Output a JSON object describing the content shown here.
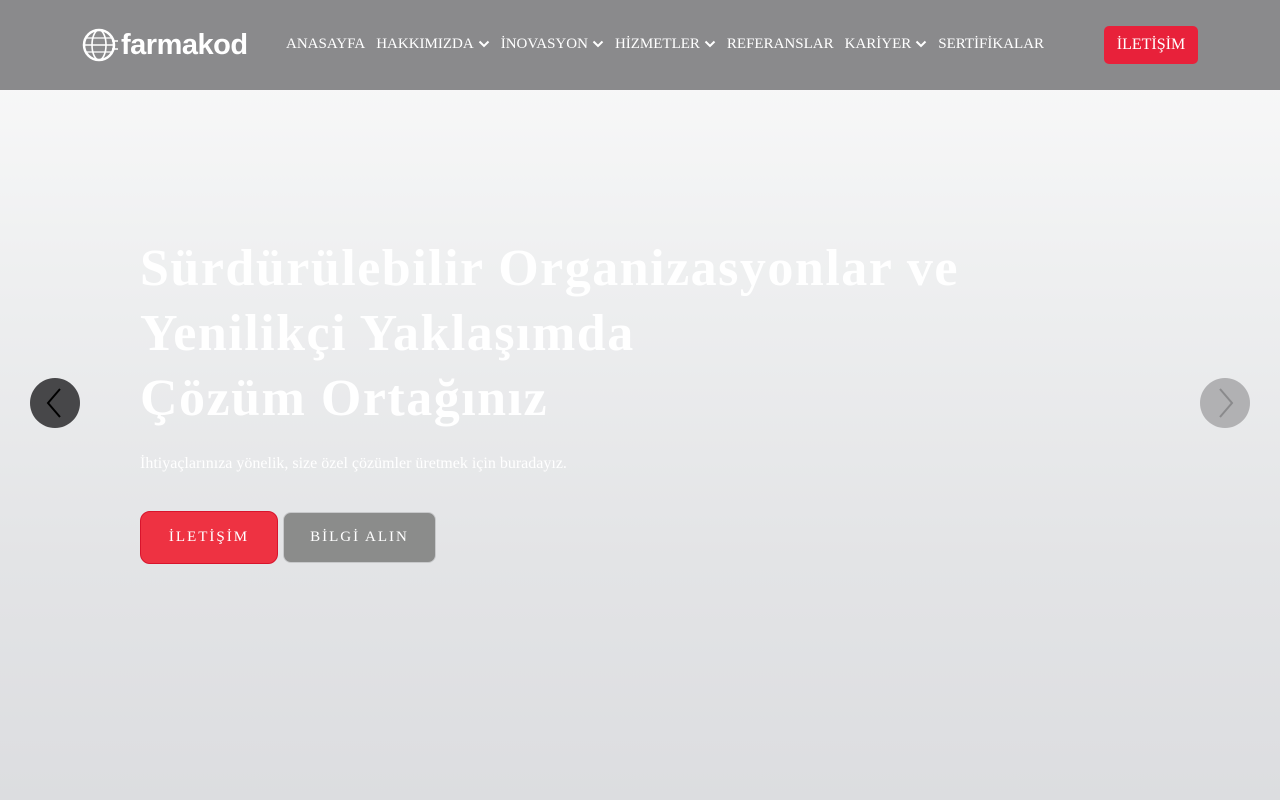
{
  "header": {
    "logo_text": "farmakod",
    "cta_label": "İLETİŞİM"
  },
  "nav": {
    "items": [
      {
        "label": "ANASAYFA",
        "has_dropdown": false
      },
      {
        "label": "HAKKIMIZDA",
        "has_dropdown": true
      },
      {
        "label": "İNOVASYON",
        "has_dropdown": true
      },
      {
        "label": "HİZMETLER",
        "has_dropdown": true
      },
      {
        "label": "REFERANSLAR",
        "has_dropdown": false
      },
      {
        "label": "KARİYER",
        "has_dropdown": true
      },
      {
        "label": "SERTİFİKALAR",
        "has_dropdown": false
      }
    ]
  },
  "hero": {
    "title_line1": "Sürdürülebilir Organizasyonlar ve",
    "title_line2": "Yenilikçi Yaklaşımda",
    "title_line3": "Çözüm Ortağınız",
    "subtitle": "İhtiyaçlarınıza yönelik, size özel çözümler üretmek için buradayız.",
    "primary_button": "İLETİŞİM",
    "secondary_button": "BİLGİ ALIN"
  },
  "carousel": {
    "prev_icon": "chevron-left-icon",
    "next_icon": "chevron-right-icon"
  },
  "colors": {
    "header_bg": "#8a8a8c",
    "accent": "#e8213a",
    "secondary_button": "#8b8c8b"
  }
}
